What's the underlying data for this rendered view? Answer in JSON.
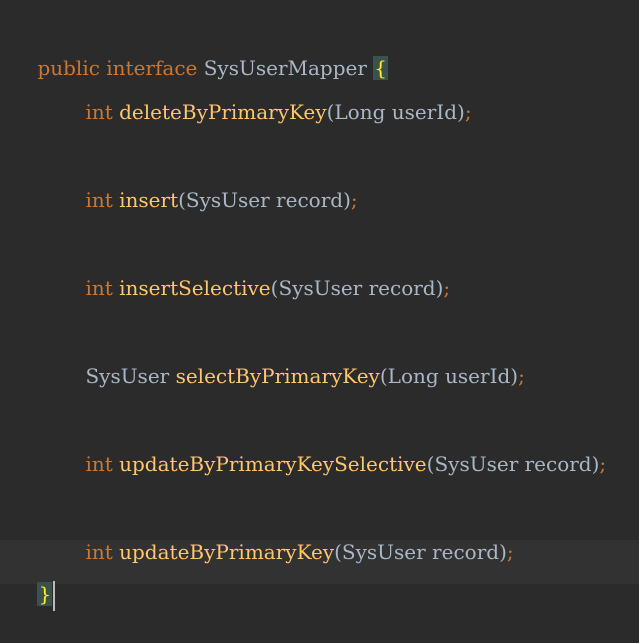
{
  "colors": {
    "background": "#2b2b2b",
    "keyword": "#cc7832",
    "identifier": "#a9b7c6",
    "method": "#ffc66d",
    "brace_highlight_bg": "#3b514d",
    "brace_highlight_fg": "#ffef28"
  },
  "code": {
    "decl": {
      "kw_public": "public",
      "kw_interface": "interface",
      "name": "SysUserMapper",
      "open_brace": "{"
    },
    "methods": [
      {
        "ret": "int",
        "name": "deleteByPrimaryKey",
        "params": "Long userId"
      },
      {
        "ret": "int",
        "name": "insert",
        "params": "SysUser record"
      },
      {
        "ret": "int",
        "name": "insertSelective",
        "params": "SysUser record"
      },
      {
        "ret": "SysUser",
        "name": "selectByPrimaryKey",
        "params": "Long userId"
      },
      {
        "ret": "int",
        "name": "updateByPrimaryKeySelective",
        "params": "SysUser record"
      },
      {
        "ret": "int",
        "name": "updateByPrimaryKey",
        "params": "SysUser record"
      }
    ],
    "close_brace": "}",
    "paren_open": "(",
    "paren_close": ")",
    "semicolon": ";"
  }
}
